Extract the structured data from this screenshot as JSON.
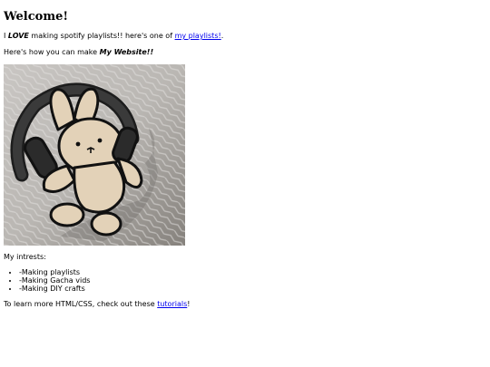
{
  "heading": "Welcome!",
  "intro": {
    "prefix": "I ",
    "emphasis": "LOVE",
    "middle": " making spotify playlists!! here's one of ",
    "link_text": "my playlists!",
    "suffix": "."
  },
  "howto": {
    "prefix": "Here's how you can make ",
    "emphasis": "My Website!!"
  },
  "image": {
    "alt": "bunny with headphones drawing"
  },
  "interests": {
    "label": "My intrests:",
    "items": [
      "-Making playlists",
      "-Making Gacha vids",
      "-Making DIY crafts"
    ]
  },
  "footer": {
    "prefix": "To learn more HTML/CSS, check out these ",
    "link_text": "tutorials",
    "suffix": "!"
  }
}
